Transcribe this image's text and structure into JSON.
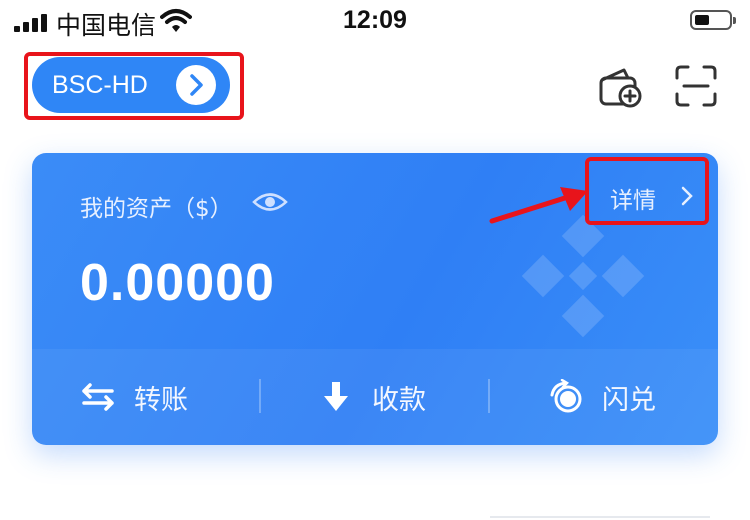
{
  "status_bar": {
    "carrier": "中国电信",
    "time": "12:09",
    "battery_level": 0.35
  },
  "header": {
    "wallet_name": "BSC-HD",
    "icons": [
      "chevron-right-icon",
      "add-wallet-icon",
      "scan-icon"
    ]
  },
  "asset_card": {
    "label": "我的资产（$）",
    "detail_label": "详情",
    "balance": "0.00000",
    "watermark": "bnb-logo",
    "actions": [
      {
        "label": "转账",
        "icon": "transfer-icon"
      },
      {
        "label": "收款",
        "icon": "receive-icon"
      },
      {
        "label": "闪兑",
        "icon": "swap-icon"
      }
    ]
  },
  "colors": {
    "card": "#2f7ff5",
    "pill": "#2f86f6",
    "highlight": "#e8141b"
  }
}
